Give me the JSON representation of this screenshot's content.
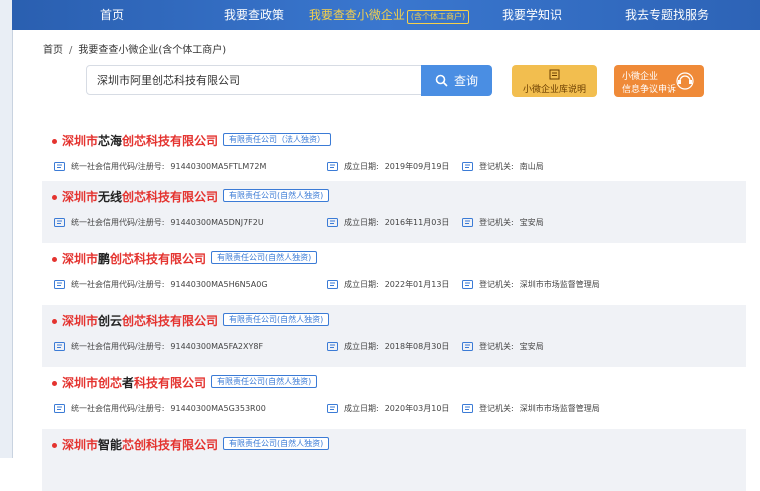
{
  "nav": {
    "items": [
      {
        "label": "首页",
        "small": ""
      },
      {
        "label": "我要查政策",
        "small": ""
      },
      {
        "label": "我要查查小微企业",
        "small": "(含个体工商户)"
      },
      {
        "label": "我要学知识",
        "small": ""
      },
      {
        "label": "我去专题找服务",
        "small": ""
      }
    ],
    "active_index": 2
  },
  "breadcrumb": {
    "home": "首页",
    "sep": "/",
    "current": "我要查查小微企业(含个体工商户)"
  },
  "search": {
    "value": "深圳市阿里创芯科技有限公司",
    "button": "查询"
  },
  "cards": {
    "library": "小微企业库说明",
    "appeal_line1": "小微企业",
    "appeal_line2": "信息争议申诉"
  },
  "results": [
    {
      "name_parts": [
        {
          "t": "深圳市",
          "hl": true
        },
        {
          "t": "芯海",
          "hl": false
        },
        {
          "t": "创芯科技有限公司",
          "hl": true
        }
      ],
      "type": "有限责任公司（法人独资）",
      "credit_label": "统一社会信用代码/注册号:",
      "credit": "91440300MA5FTLM72M",
      "date_label": "成立日期:",
      "date": "2019年09月19日",
      "auth_label": "登记机关:",
      "auth": "南山局"
    },
    {
      "name_parts": [
        {
          "t": "深圳市",
          "hl": true
        },
        {
          "t": "无线",
          "hl": false
        },
        {
          "t": "创芯科技有限公司",
          "hl": true
        }
      ],
      "type": "有限责任公司(自然人独资)",
      "credit_label": "统一社会信用代码/注册号:",
      "credit": "91440300MA5DNJ7F2U",
      "date_label": "成立日期:",
      "date": "2016年11月03日",
      "auth_label": "登记机关:",
      "auth": "宝安局"
    },
    {
      "name_parts": [
        {
          "t": "深圳市",
          "hl": true
        },
        {
          "t": "鹏",
          "hl": false
        },
        {
          "t": "创芯科技有限公司",
          "hl": true
        }
      ],
      "type": "有限责任公司(自然人独资)",
      "credit_label": "统一社会信用代码/注册号:",
      "credit": "91440300MA5H6N5A0G",
      "date_label": "成立日期:",
      "date": "2022年01月13日",
      "auth_label": "登记机关:",
      "auth": "深圳市市场监督管理局"
    },
    {
      "name_parts": [
        {
          "t": "深圳市",
          "hl": true
        },
        {
          "t": "创云",
          "hl": false
        },
        {
          "t": "创芯科技有限公司",
          "hl": true
        }
      ],
      "type": "有限责任公司(自然人独资)",
      "credit_label": "统一社会信用代码/注册号:",
      "credit": "91440300MA5FA2XY8F",
      "date_label": "成立日期:",
      "date": "2018年08月30日",
      "auth_label": "登记机关:",
      "auth": "宝安局"
    },
    {
      "name_parts": [
        {
          "t": "深圳市",
          "hl": true
        },
        {
          "t": "创芯",
          "hl": true
        },
        {
          "t": "者",
          "hl": false
        },
        {
          "t": "科技有限公司",
          "hl": true
        }
      ],
      "type": "有限责任公司(自然人独资)",
      "credit_label": "统一社会信用代码/注册号:",
      "credit": "91440300MA5G353R00",
      "date_label": "成立日期:",
      "date": "2020年03月10日",
      "auth_label": "登记机关:",
      "auth": "深圳市市场监督管理局"
    },
    {
      "name_parts": [
        {
          "t": "深圳市",
          "hl": true
        },
        {
          "t": "智能",
          "hl": false
        },
        {
          "t": "芯创科技有限公司",
          "hl": true
        }
      ],
      "type": "有限责任公司(自然人独资)",
      "credit_label": "",
      "credit": "",
      "date_label": "",
      "date": "",
      "auth_label": "",
      "auth": ""
    }
  ],
  "colors": {
    "nav": "#2f69bf",
    "active": "#f5d04b",
    "highlight": "#e4332f",
    "tag": "#3b7bd6"
  }
}
